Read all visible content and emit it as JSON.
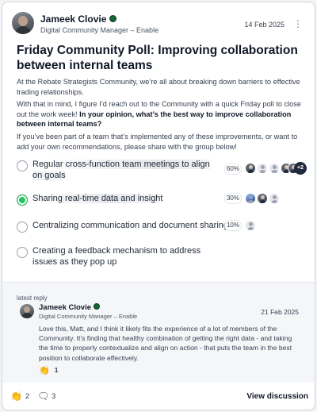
{
  "post": {
    "author": "Jameek Clovie",
    "role": "Digital Community Manager – Enable",
    "date": "14 Feb 2025",
    "title": "Friday Community Poll: Improving collaboration between internal teams",
    "intro": "At the Rebate Strategists Community, we’re all about breaking down barriers to effective trading relationships.",
    "question_lead": "With that in mind, I figure I’d reach out to the Community with a quick Friday poll to close out the work week! ",
    "question_bold": "In your opinion, what’s the best way to improve collaboration between internal teams?",
    "closing": "If you’ve been part of a team that’s implemented any of these improvements, or want to add your own recommendations, please share with the group below!"
  },
  "poll": {
    "options": [
      {
        "label": "Regular cross-function team meetings to align on goals",
        "percent": "60%",
        "more_voters": "+2"
      },
      {
        "label": "Sharing real-time data and insight",
        "percent": "30%"
      },
      {
        "label": "Centralizing communication and document sharing",
        "percent": "10%"
      },
      {
        "label": "Creating a feedback mechanism to address issues as they pop up",
        "percent": ""
      }
    ],
    "selected_index": 1
  },
  "reply": {
    "heading": "latest reply",
    "author": "Jameek Clovie",
    "role": "Digital Community Manager – Enable",
    "date": "21 Feb 2025",
    "body": "Love this, Matt, and I think it likely fits the experience of a lot of members of the Community. It’s finding that healthy combination of getting the right data - and taking the time to properly contextualize and align on action - that puts the team in the best position to collaborate effectively.",
    "likes": "1"
  },
  "footer": {
    "likes": "2",
    "comments": "3",
    "view_label": "View discussion"
  },
  "colors": {
    "accent": "#22c55e",
    "badge": "#166534",
    "dark": "#1e293b"
  },
  "icons": [
    "kebab-menu-icon",
    "verified-badge-icon",
    "clap-icon",
    "comment-icon"
  ]
}
